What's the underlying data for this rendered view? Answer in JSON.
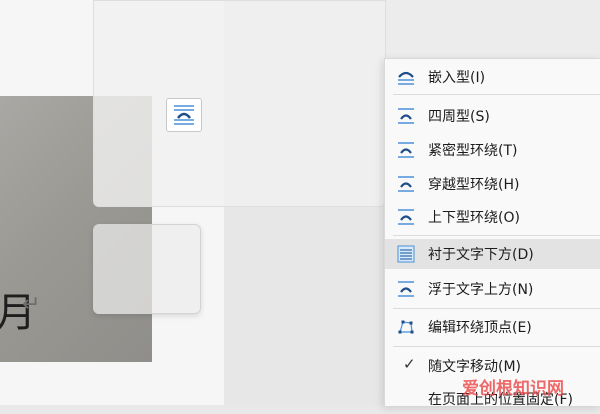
{
  "document": {
    "visible_char": "月",
    "return_mark": "↵"
  },
  "context_menu": {
    "items": [
      {
        "label": "嵌入型(I)",
        "icon": "wrap-inline-icon"
      },
      {
        "label": "四周型(S)",
        "icon": "wrap-square-icon"
      },
      {
        "label": "紧密型环绕(T)",
        "icon": "wrap-tight-icon"
      },
      {
        "label": "穿越型环绕(H)",
        "icon": "wrap-through-icon"
      },
      {
        "label": "上下型环绕(O)",
        "icon": "wrap-top-bottom-icon"
      },
      {
        "label": "衬于文字下方(D)",
        "icon": "behind-text-icon",
        "highlighted": true
      },
      {
        "label": "浮于文字上方(N)",
        "icon": "in-front-of-text-icon"
      },
      {
        "label": "编辑环绕顶点(E)",
        "icon": "edit-wrap-points-icon"
      },
      {
        "label": "随文字移动(M)",
        "icon": "check-icon",
        "checked": true
      },
      {
        "label": "在页面上的位置固定(F)",
        "icon": "none"
      }
    ]
  },
  "watermark": {
    "text": "爱创根知识网"
  },
  "colors": {
    "icon_blue": "#2b6cb0",
    "icon_line": "#4a90d9",
    "highlight": "#e3e3e3"
  }
}
